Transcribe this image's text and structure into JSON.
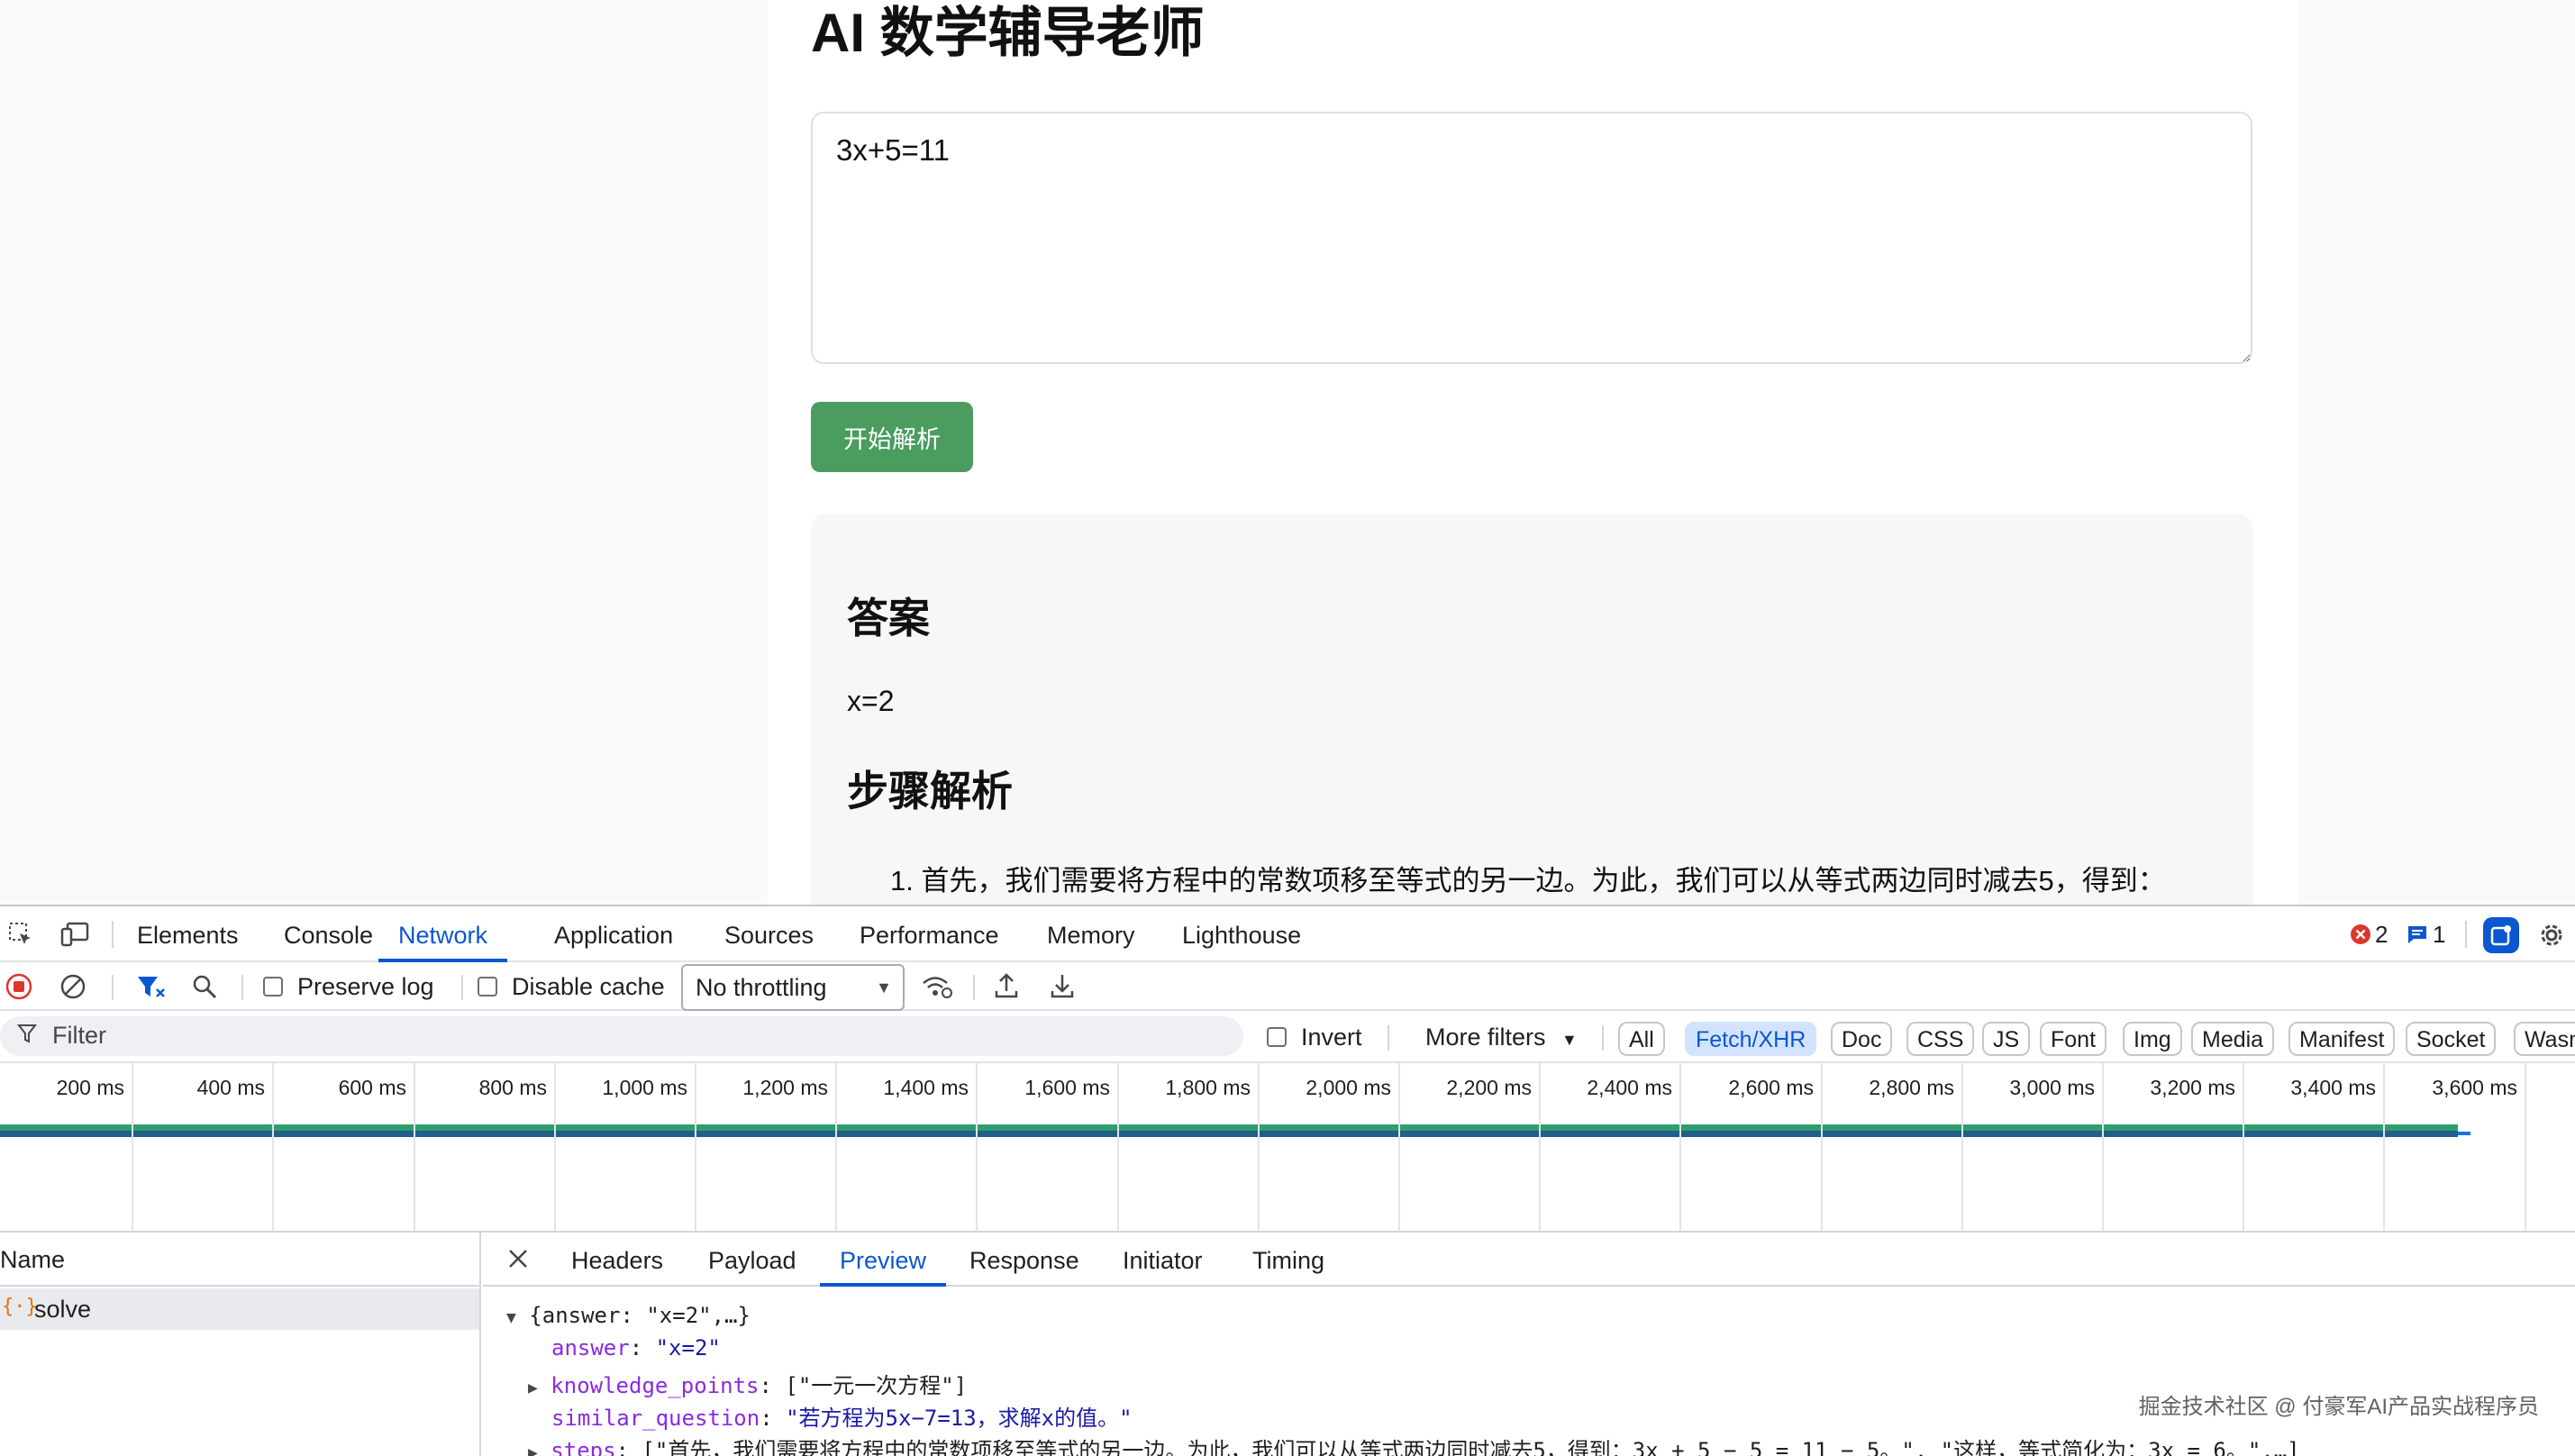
{
  "page": {
    "title": "AI 数学辅导老师",
    "input_value": "3x+5=11",
    "solve_button": "开始解析",
    "answer_heading": "答案",
    "answer_value": "x=2",
    "steps_heading": "步骤解析",
    "step1": "1. 首先，我们需要将方程中的常数项移至等式的另一边。为此，我们可以从等式两边同时减去5，得到："
  },
  "devtools": {
    "tabs": [
      "Elements",
      "Console",
      "Network",
      "Application",
      "Sources",
      "Performance",
      "Memory",
      "Lighthouse"
    ],
    "active_tab": "Network",
    "error_count": "2",
    "message_count": "1",
    "toolbar": {
      "preserve_log": "Preserve log",
      "disable_cache": "Disable cache",
      "throttling": "No throttling"
    },
    "filter": {
      "placeholder": "Filter",
      "invert": "Invert",
      "more_filters": "More filters",
      "types": [
        "All",
        "Fetch/XHR",
        "Doc",
        "CSS",
        "JS",
        "Font",
        "Img",
        "Media",
        "Manifest",
        "Socket",
        "Wasm"
      ],
      "active_type": "Fetch/XHR"
    },
    "timeline_ticks": [
      "200 ms",
      "400 ms",
      "600 ms",
      "800 ms",
      "1,000 ms",
      "1,200 ms",
      "1,400 ms",
      "1,600 ms",
      "1,800 ms",
      "2,000 ms",
      "2,200 ms",
      "2,400 ms",
      "2,600 ms",
      "2,800 ms",
      "3,000 ms",
      "3,200 ms",
      "3,400 ms",
      "3,600 ms"
    ],
    "list": {
      "header": "Name",
      "rows": [
        "solve"
      ]
    },
    "detail_tabs": [
      "Headers",
      "Payload",
      "Preview",
      "Response",
      "Initiator",
      "Timing"
    ],
    "active_detail_tab": "Preview",
    "preview": {
      "root": "{answer: \"x=2\",…}",
      "answer_key": "answer",
      "answer_val": "\"x=2\"",
      "kp_key": "knowledge_points",
      "kp_val": "[\"一元一次方程\"]",
      "sq_key": "similar_question",
      "sq_val": "\"若方程为5x−7=13，求解x的值。\"",
      "steps_key": "steps",
      "steps_val": "[\"首先，我们需要将方程中的常数项移至等式的另一边。为此，我们可以从等式两边同时减去5，得到：3x + 5 − 5 = 11 − 5。\", \"这样，等式简化为：3x = 6。\",…]"
    }
  },
  "watermark": "掘金技术社区 @ 付豪军AI产品实战程序员"
}
